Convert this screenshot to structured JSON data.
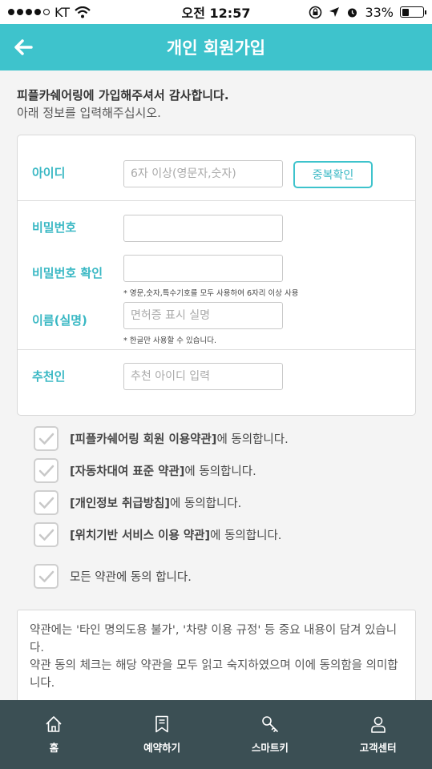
{
  "status_bar": {
    "carrier": "KT",
    "time": "오전 12:57",
    "battery_percent": "33%",
    "battery_level": 0.33
  },
  "header": {
    "title": "개인 회원가입"
  },
  "intro": {
    "thanks": "피플카쉐어링에 가입해주셔서 감사합니다.",
    "instruction": "아래 정보를 입력해주십시오."
  },
  "form": {
    "id_label": "아이디",
    "id_placeholder": "6자 이상(영문자,숫자)",
    "dup_check": "중복확인",
    "pw_label": "비밀번호",
    "pw_confirm_label": "비밀번호 확인",
    "pw_hint": "* 영문,숫자,특수기호를 모두 사용하여 6자리 이상 사용",
    "name_label": "이름(실명)",
    "name_placeholder": "면허증 표시 실명",
    "name_hint": "* 한글만 사용할 수 있습니다.",
    "referrer_label": "추천인",
    "referrer_placeholder": "추천 아이디 입력"
  },
  "agreements": [
    {
      "bold": "[피플카쉐어링 회원 이용약관]",
      "rest": "에 동의합니다."
    },
    {
      "bold": "[자동차대여 표준 약관]",
      "rest": "에 동의합니다."
    },
    {
      "bold": "[개인정보 취급방침]",
      "rest": "에 동의합니다."
    },
    {
      "bold": "[위치기반 서비스 이용 약관]",
      "rest": "에 동의합니다."
    }
  ],
  "agree_all": "모든 약관에 동의 합니다.",
  "notice": {
    "line1": "약관에는 '타인 명의도용 불가', '차량 이용 규정' 등 중요 내용이 담겨 있습니다.",
    "line2": "약관 동의 체크는 해당 약관을 모두 읽고 숙지하였으며 이에 동의함을 의미합니다."
  },
  "nav": [
    {
      "label": "홈",
      "icon": "home-icon"
    },
    {
      "label": "예약하기",
      "icon": "bookmark-icon"
    },
    {
      "label": "스마트키",
      "icon": "key-icon"
    },
    {
      "label": "고객센터",
      "icon": "person-icon"
    }
  ]
}
